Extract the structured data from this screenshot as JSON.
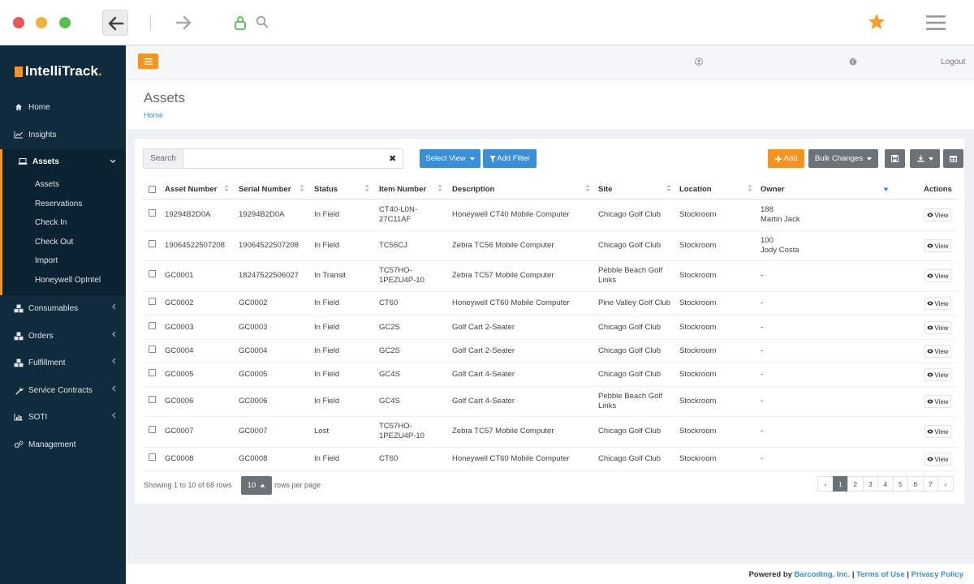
{
  "brand": {
    "name": "IntelliTrack",
    "dot": "."
  },
  "topbar": {
    "logout": "Logout"
  },
  "sidebar": {
    "items": [
      {
        "label": "Home"
      },
      {
        "label": "Insights"
      },
      {
        "label": "Assets"
      },
      {
        "label": "Consumables"
      },
      {
        "label": "Orders"
      },
      {
        "label": "Fulfillment"
      },
      {
        "label": "Service Contracts"
      },
      {
        "label": "SOTI"
      },
      {
        "label": "Management"
      }
    ],
    "asset_subitems": [
      "Assets",
      "Reservations",
      "Check In",
      "Check Out",
      "Import",
      "Honeywell OpIntel"
    ]
  },
  "page": {
    "title": "Assets",
    "breadcrumb": "Home"
  },
  "toolbar": {
    "search_label": "Search",
    "search_value": "",
    "clear": "✖",
    "select_view": "Select View",
    "add_filter": "Add Filter",
    "add": "Add",
    "bulk_changes": "Bulk Changes"
  },
  "table": {
    "columns": [
      "Asset Number",
      "Serial Number",
      "Status",
      "Item Number",
      "Description",
      "Site",
      "Location",
      "Owner",
      "Actions"
    ],
    "view_label": "View",
    "rows": [
      {
        "asset": "19294B2D0A",
        "serial": "19294B2D0A",
        "status": "In Field",
        "item": [
          "CT40-L0N-",
          "27C11AF"
        ],
        "desc": "Honeywell CT40 Mobile Computer",
        "site": [
          "Chicago Golf Club"
        ],
        "location": "Stockroom",
        "owner": [
          "188",
          "Martin Jack"
        ]
      },
      {
        "asset": "19064522507208",
        "serial": "19064522507208",
        "status": "In Field",
        "item": [
          "TC56CJ"
        ],
        "desc": "Zebra TC56 Mobile Computer",
        "site": [
          "Chicago Golf Club"
        ],
        "location": "Stockroom",
        "owner": [
          "100",
          "Jody Costa"
        ]
      },
      {
        "asset": "GC0001",
        "serial": "18247522506027",
        "status": "In Transit",
        "item": [
          "TC57HO-",
          "1PEZU4P-10"
        ],
        "desc": "Zebra TC57 Mobile Computer",
        "site": [
          "Pebble Beach Golf",
          "Links"
        ],
        "location": "Stockroom",
        "owner": [
          "-"
        ]
      },
      {
        "asset": "GC0002",
        "serial": "GC0002",
        "status": "In Field",
        "item": [
          "CT60"
        ],
        "desc": "Honeywell CT60 Mobile Computer",
        "site": [
          "Pine Valley Golf Club"
        ],
        "location": "Stockroom",
        "owner": [
          "-"
        ]
      },
      {
        "asset": "GC0003",
        "serial": "GC0003",
        "status": "In Field",
        "item": [
          "GC2S"
        ],
        "desc": "Golf Cart 2-Seater",
        "site": [
          "Chicago Golf Club"
        ],
        "location": "Stockroom",
        "owner": [
          "-"
        ]
      },
      {
        "asset": "GC0004",
        "serial": "GC0004",
        "status": "In Field",
        "item": [
          "GC2S"
        ],
        "desc": "Golf Cart 2-Seater",
        "site": [
          "Chicago Golf Club"
        ],
        "location": "Stockroom",
        "owner": [
          "-"
        ]
      },
      {
        "asset": "GC0005",
        "serial": "GC0005",
        "status": "In Field",
        "item": [
          "GC4S"
        ],
        "desc": "Golf Cart 4-Seater",
        "site": [
          "Chicago Golf Club"
        ],
        "location": "Stockroom",
        "owner": [
          "-"
        ]
      },
      {
        "asset": "GC0006",
        "serial": "GC0006",
        "status": "In Field",
        "item": [
          "GC4S"
        ],
        "desc": "Golf Cart 4-Seater",
        "site": [
          "Pebble Beach Golf",
          "Links"
        ],
        "location": "Stockroom",
        "owner": [
          "-"
        ]
      },
      {
        "asset": "GC0007",
        "serial": "GC0007",
        "status": "Lost",
        "item": [
          "TC57HO-",
          "1PEZU4P-10"
        ],
        "desc": "Zebra TC57 Mobile Computer",
        "site": [
          "Chicago Golf Club"
        ],
        "location": "Stockroom",
        "owner": [
          "-"
        ]
      },
      {
        "asset": "GC0008",
        "serial": "GC0008",
        "status": "In Field",
        "item": [
          "CT60"
        ],
        "desc": "Honeywell CT60 Mobile Computer",
        "site": [
          "Chicago Golf Club"
        ],
        "location": "Stockroom",
        "owner": [
          "-"
        ]
      }
    ]
  },
  "pagination": {
    "info": "Showing 1 to 10 of 68 rows",
    "page_size": "10",
    "rows_per_page": "rows per page",
    "prev": "‹",
    "pages": [
      "1",
      "2",
      "3",
      "4",
      "5",
      "6",
      "7"
    ],
    "next": "›",
    "active_page": "1"
  },
  "footer": {
    "powered_by": "Powered by",
    "company": "Barcoding, Inc.",
    "sep1": "|",
    "terms": "Terms of Use",
    "sep2": "|",
    "privacy": "Privacy Policy"
  },
  "colors": {
    "accent_orange": "#f7941d",
    "sidebar": "#0f2b3c",
    "primary_blue": "#3a8fd8",
    "neutral_gray": "#6c7378"
  },
  "icons": {
    "back": "arrow-left-icon",
    "forward": "arrow-right-icon",
    "lock": "lock-icon",
    "star": "star-icon",
    "menu": "hamburger-icon"
  }
}
